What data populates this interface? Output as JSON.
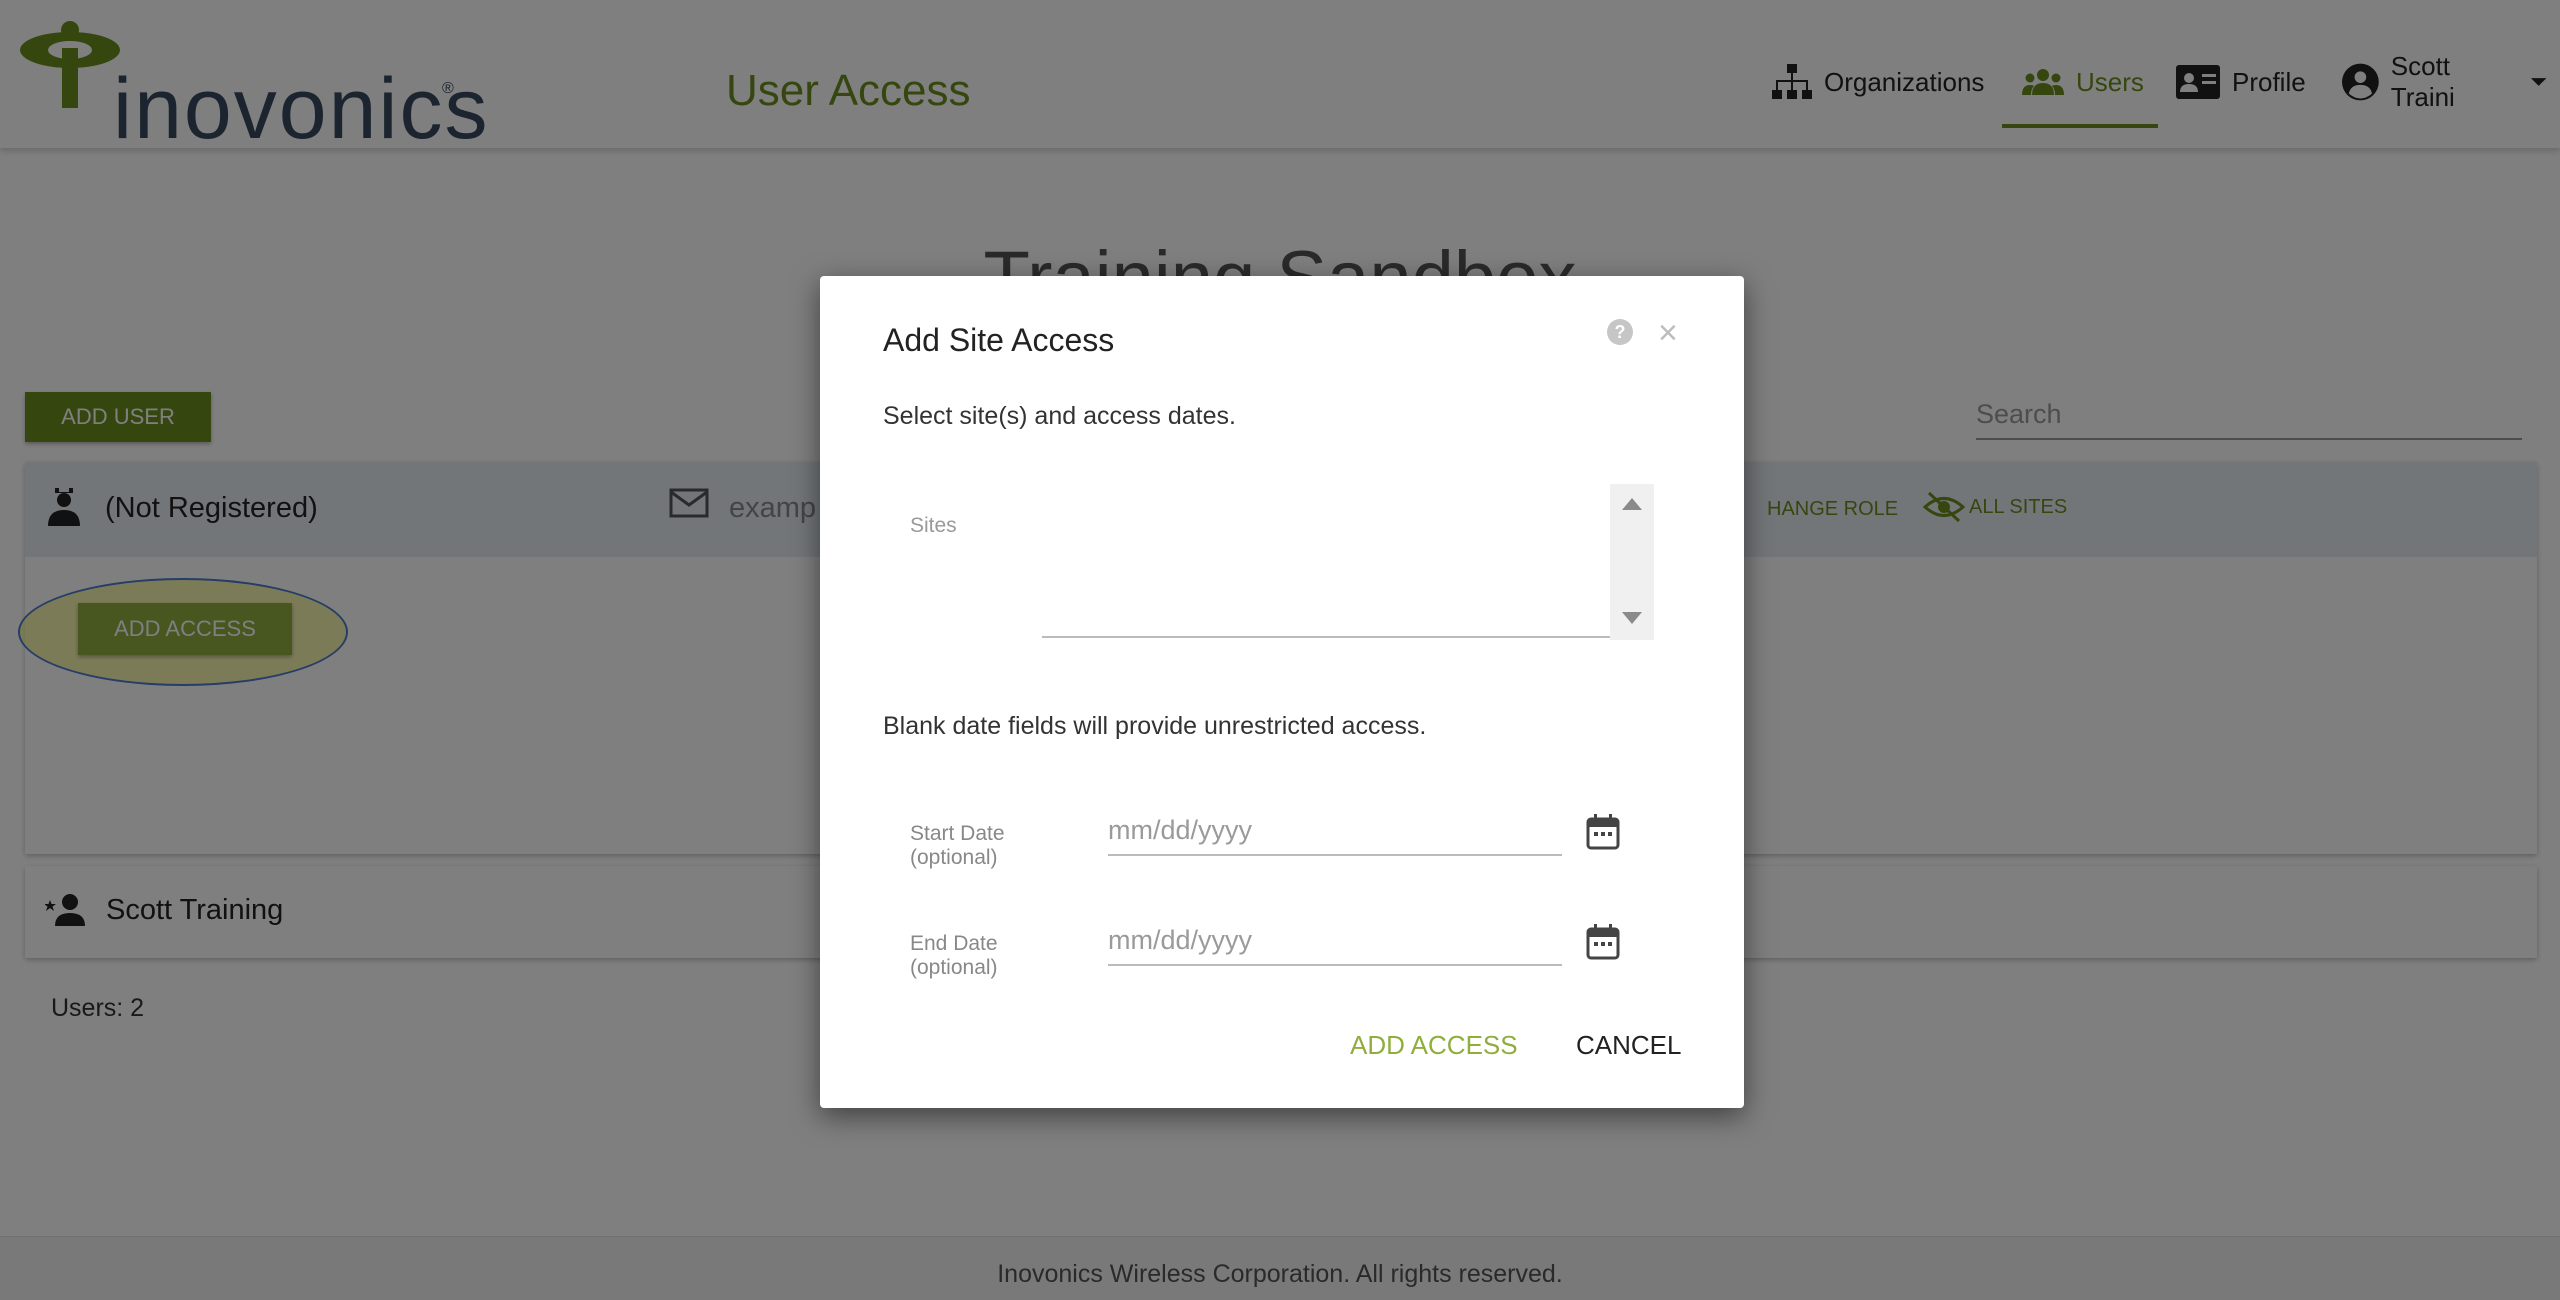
{
  "header": {
    "logo_text": "inovonics",
    "logo_mark": "®",
    "title": "User Access",
    "nav": {
      "organizations": "Organizations",
      "users": "Users",
      "profile": "Profile",
      "user_name": "Scott Traini"
    }
  },
  "page": {
    "org_title": "Training Sandbox",
    "add_user_label": "ADD USER",
    "search_placeholder": "Search",
    "users": [
      {
        "name": "(Not Registered)",
        "email": "examp",
        "change_role_label": "HANGE ROLE",
        "all_sites_label": "ALL SITES",
        "add_access_label": "ADD ACCESS"
      },
      {
        "name": "Scott Training"
      }
    ],
    "users_count": "Users: 2"
  },
  "footer": {
    "text": "Inovonics Wireless Corporation. All rights reserved."
  },
  "modal": {
    "title": "Add Site Access",
    "subtitle": "Select site(s) and access dates.",
    "sites_label": "Sites",
    "note": "Blank date fields will provide unrestricted access.",
    "start_date": {
      "label_line1": "Start Date",
      "label_line2": "(optional)",
      "placeholder": "mm/dd/yyyy"
    },
    "end_date": {
      "label_line1": "End Date",
      "label_line2": "(optional)",
      "placeholder": "mm/dd/yyyy"
    },
    "add_access_label": "ADD ACCESS",
    "cancel_label": "CANCEL"
  },
  "colors": {
    "brand_green": "#6b8f1f",
    "button_green_light": "#8fae3e",
    "card_header": "#e4ecf2",
    "overlay": "rgba(0,0,0,0.5)"
  }
}
